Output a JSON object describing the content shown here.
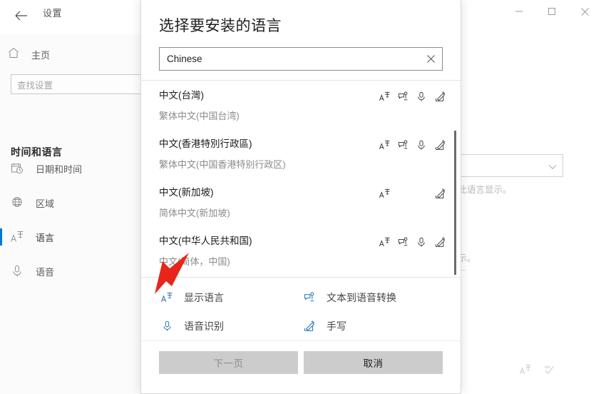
{
  "window": {
    "back_label": "back-arrow",
    "title": "设置",
    "controls": {
      "minimize": "minimize",
      "maximize": "maximize",
      "close": "close"
    }
  },
  "sidebar": {
    "home_label": "主页",
    "home_icon": "home-icon",
    "search_placeholder": "查找设置",
    "heading": "时间和语言",
    "items": [
      {
        "label": "日期和时间",
        "icon": "calendar-clock-icon",
        "selected": false
      },
      {
        "label": "区域",
        "icon": "globe-icon",
        "selected": false
      },
      {
        "label": "语言",
        "icon": "display-language-icon",
        "selected": true
      },
      {
        "label": "语音",
        "icon": "microphone-icon",
        "selected": false
      }
    ]
  },
  "background_content": {
    "partial_text_1": "用此语言显示。",
    "partial_text_2": "显示。",
    "combo_value": "",
    "icons": [
      "display-language-icon",
      "spellcheck-icon"
    ]
  },
  "dialog": {
    "title": "选择要安装的语言",
    "search": {
      "value": "Chinese",
      "placeholder": "",
      "clear_icon": "close-icon"
    },
    "languages": [
      {
        "name": "中文(台灣)",
        "sub": "繁体中文(中国台湾)",
        "features": [
          "display-language",
          "text-to-speech",
          "speech-recognition",
          "handwriting"
        ]
      },
      {
        "name": "中文(香港特別行政區)",
        "sub": "繁体中文(中国香港特别行政区)",
        "features": [
          "display-language",
          "text-to-speech",
          "speech-recognition",
          "handwriting"
        ]
      },
      {
        "name": "中文(新加坡)",
        "sub": "简体中文(新加坡)",
        "features": [
          "display-language",
          "handwriting"
        ]
      },
      {
        "name": "中文(中华人民共和国)",
        "sub": "中文(简体，中国)",
        "features": [
          "display-language",
          "text-to-speech",
          "speech-recognition",
          "handwriting"
        ]
      }
    ],
    "legend": [
      {
        "label": "显示语言",
        "icon": "display-language-icon"
      },
      {
        "label": "文本到语音转换",
        "icon": "text-to-speech-icon"
      },
      {
        "label": "语音识别",
        "icon": "microphone-icon"
      },
      {
        "label": "手写",
        "icon": "handwriting-icon"
      }
    ],
    "buttons": {
      "next": "下一页",
      "cancel": "取消"
    }
  },
  "annotation": {
    "arrow_color": "#e8251b",
    "shape": "arrow-pointing-up-right"
  },
  "colors": {
    "accent": "#0078d7",
    "legend_icon": "#1f6fb2",
    "button_bg": "#cccccc"
  }
}
